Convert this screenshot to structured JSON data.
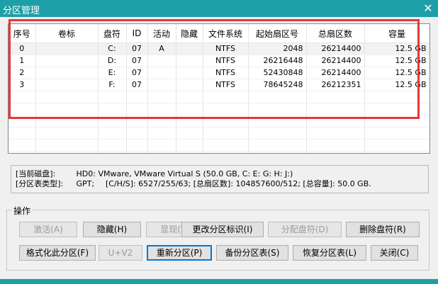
{
  "window": {
    "title": "分区管理",
    "close_glyph": "✕"
  },
  "table": {
    "headers": [
      "序号",
      "卷标",
      "盘符",
      "ID",
      "活动",
      "隐藏",
      "文件系统",
      "起始扇区号",
      "总扇区数",
      "容量"
    ],
    "rows": [
      [
        "0",
        "",
        "C:",
        "07",
        "A",
        "",
        "NTFS",
        "2048",
        "26214400",
        "12.5 GB"
      ],
      [
        "1",
        "",
        "D:",
        "07",
        "",
        "",
        "NTFS",
        "26216448",
        "26214400",
        "12.5 GB"
      ],
      [
        "2",
        "",
        "E:",
        "07",
        "",
        "",
        "NTFS",
        "52430848",
        "26214400",
        "12.5 GB"
      ],
      [
        "3",
        "",
        "F:",
        "07",
        "",
        "",
        "NTFS",
        "78645248",
        "26212351",
        "12.5 GB"
      ]
    ]
  },
  "info": {
    "line1_label": "[当前磁盘]:",
    "line1_value": "HD0: VMware, VMware Virtual S (50.0 GB, C: E: G: H: J:)",
    "line2_label": "[分区表类型]:",
    "line2_type": "GPT;",
    "line2_rest": "[C/H/S]: 6527/255/63; [总扇区数]: 104857600/512; [总容量]: 50.0 GB."
  },
  "ops": {
    "title": "操作",
    "row1": [
      "激活(A)",
      "隐藏(H)",
      "显现(V)",
      "更改分区标识(I)",
      "分配盘符(D)",
      "删除盘符(R)"
    ],
    "row2": [
      "格式化此分区(F)",
      "U+V2",
      "重新分区(P)",
      "备份分区表(S)",
      "恢复分区表(L)",
      "关闭(C)"
    ]
  }
}
